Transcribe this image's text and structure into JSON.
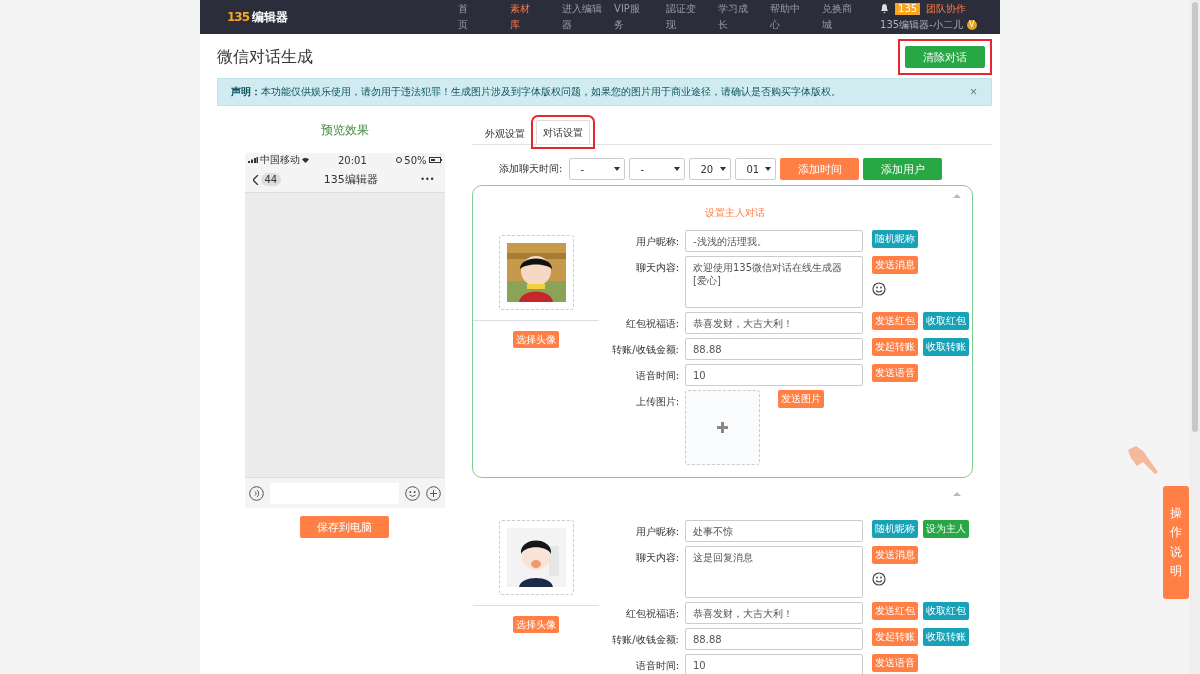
{
  "nav": {
    "logo_mark": "135",
    "logo_text": "编辑器",
    "items": [
      {
        "top": "首",
        "bottom": "页",
        "selected": false
      },
      {
        "top": "素材",
        "bottom": "库",
        "selected": true
      },
      {
        "top": "进入编辑",
        "bottom": "器",
        "selected": false
      },
      {
        "top": "VIP服",
        "bottom": "务",
        "selected": false
      },
      {
        "top": "認证变",
        "bottom": "现",
        "selected": false
      },
      {
        "top": "学习成",
        "bottom": "长",
        "selected": false
      },
      {
        "top": "帮助中",
        "bottom": "心",
        "selected": false
      },
      {
        "top": "兑换商",
        "bottom": "城",
        "selected": false
      }
    ],
    "badge": "135",
    "team": "团队协作",
    "user": "135编辑器-小二儿",
    "vip": "V"
  },
  "page_title": "微信对话生成",
  "clear_button": {
    "label": "清除对话",
    "highlighted": true
  },
  "notice": {
    "text": "**声明：**本功能仅供娱乐使用，请勿用于违法犯罪！生成图片涉及到字体版权问题，如果您的图片用于商业途径，请确认是否购买字体版权。",
    "close": "×"
  },
  "preview": {
    "title": "预览效果",
    "carrier": "中国移动",
    "time": "20:01",
    "battery": "50%",
    "back_count": "44",
    "chat_title": "135编辑器",
    "more": "•••",
    "save_button": "保存到电脑"
  },
  "tabs": [
    {
      "label": "外观设置",
      "selected": false,
      "highlighted": false
    },
    {
      "label": "对话设置",
      "selected": true,
      "highlighted": true
    }
  ],
  "time_row": {
    "label": "添加聊天时间:",
    "selects": [
      "-",
      "-",
      "20",
      "01"
    ],
    "add_time": "添加时间",
    "add_user": "添加用户"
  },
  "users": [
    {
      "kind": "host",
      "title": "设置主人对话",
      "choose_avatar": "选择头像",
      "rows": [
        {
          "kind": "input",
          "label": "用户昵称:",
          "value": "-浅浅的活理我。",
          "buttons": [
            {
              "label": "随机昵称",
              "kind": "teal"
            }
          ]
        },
        {
          "kind": "textarea",
          "label": "聊天内容:",
          "value": "欢迎使用135微信对话在线生成器[爱心]",
          "buttons": [
            {
              "label": "发送消息",
              "kind": "orange"
            }
          ]
        },
        {
          "kind": "input",
          "label": "红包祝福语:",
          "value": "恭喜发财，大吉大利！",
          "buttons": [
            {
              "label": "发送红包",
              "kind": "orange"
            },
            {
              "label": "收取红包",
              "kind": "teal"
            }
          ]
        },
        {
          "kind": "input",
          "label": "转账/收钱金额:",
          "value": "88.88",
          "buttons": [
            {
              "label": "发起转账",
              "kind": "orange"
            },
            {
              "label": "收取转账",
              "kind": "teal"
            }
          ]
        },
        {
          "kind": "input",
          "label": "语音时间:",
          "value": "10",
          "buttons": [
            {
              "label": "发送语音",
              "kind": "orange"
            }
          ]
        },
        {
          "kind": "upload",
          "label": "上传图片:",
          "buttons": [
            {
              "label": "发送图片",
              "kind": "orange"
            }
          ]
        }
      ]
    },
    {
      "kind": "guest",
      "choose_avatar": "选择头像",
      "rows": [
        {
          "kind": "input",
          "label": "用户昵称:",
          "value": "处事不惊",
          "buttons": [
            {
              "label": "随机昵称",
              "kind": "teal"
            },
            {
              "label": "设为主人",
              "kind": "green"
            }
          ]
        },
        {
          "kind": "textarea",
          "label": "聊天内容:",
          "value": "这是回复消息",
          "buttons": [
            {
              "label": "发送消息",
              "kind": "orange"
            }
          ]
        },
        {
          "kind": "input",
          "label": "红包祝福语:",
          "value": "恭喜发财，大吉大利！",
          "buttons": [
            {
              "label": "发送红包",
              "kind": "orange"
            },
            {
              "label": "收取红包",
              "kind": "teal"
            }
          ]
        },
        {
          "kind": "input",
          "label": "转账/收钱金额:",
          "value": "88.88",
          "buttons": [
            {
              "label": "发起转账",
              "kind": "orange"
            },
            {
              "label": "收取转账",
              "kind": "teal"
            }
          ]
        },
        {
          "kind": "input",
          "label": "语音时间:",
          "value": "10",
          "buttons": [
            {
              "label": "发送语音",
              "kind": "orange"
            }
          ]
        }
      ]
    }
  ],
  "help_tab": "操作说明"
}
